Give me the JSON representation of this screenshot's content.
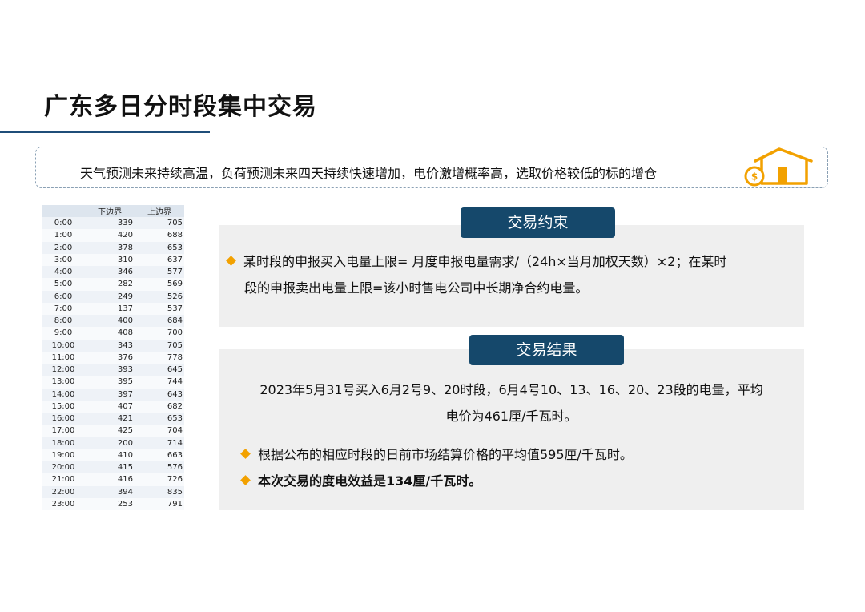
{
  "title": "广东多日分时段集中交易",
  "banner": {
    "text": "天气预测未来持续高温，负荷预测未来四天持续快速增加，电价激增概率高，选取价格较低的标的增仓",
    "icon": "house-money-icon"
  },
  "table": {
    "headers": [
      "",
      "下边界",
      "上边界"
    ],
    "rows": [
      [
        "0:00",
        "339",
        "705"
      ],
      [
        "1:00",
        "420",
        "688"
      ],
      [
        "2:00",
        "378",
        "653"
      ],
      [
        "3:00",
        "310",
        "637"
      ],
      [
        "4:00",
        "346",
        "577"
      ],
      [
        "5:00",
        "282",
        "569"
      ],
      [
        "6:00",
        "249",
        "526"
      ],
      [
        "7:00",
        "137",
        "537"
      ],
      [
        "8:00",
        "400",
        "684"
      ],
      [
        "9:00",
        "408",
        "700"
      ],
      [
        "10:00",
        "343",
        "705"
      ],
      [
        "11:00",
        "376",
        "778"
      ],
      [
        "12:00",
        "393",
        "645"
      ],
      [
        "13:00",
        "395",
        "744"
      ],
      [
        "14:00",
        "397",
        "643"
      ],
      [
        "15:00",
        "407",
        "682"
      ],
      [
        "16:00",
        "421",
        "653"
      ],
      [
        "17:00",
        "425",
        "704"
      ],
      [
        "18:00",
        "200",
        "714"
      ],
      [
        "19:00",
        "410",
        "663"
      ],
      [
        "20:00",
        "415",
        "576"
      ],
      [
        "21:00",
        "416",
        "726"
      ],
      [
        "22:00",
        "394",
        "835"
      ],
      [
        "23:00",
        "253",
        "791"
      ]
    ]
  },
  "constraint": {
    "label": "交易约束",
    "line1": "某时段的申报买入电量上限= 月度申报电量需求/（24h×当月加权天数）×2；在某时",
    "line2": "段的申报卖出电量上限=该小时售电公司中长期净合约电量。"
  },
  "result": {
    "label": "交易结果",
    "line1": "2023年5月31号买入6月2号9、20时段，6月4号10、13、16、20、23段的电量，平均",
    "line2": "电价为461厘/千瓦时。",
    "bullet1": "根据公布的相应时段的日前市场结算价格的平均值595厘/千瓦时。",
    "bullet2": "本次交易的度电效益是134厘/千瓦时。"
  },
  "colors": {
    "accent": "#15486b",
    "bullet": "#f2a100",
    "icon": "#f2a100"
  }
}
